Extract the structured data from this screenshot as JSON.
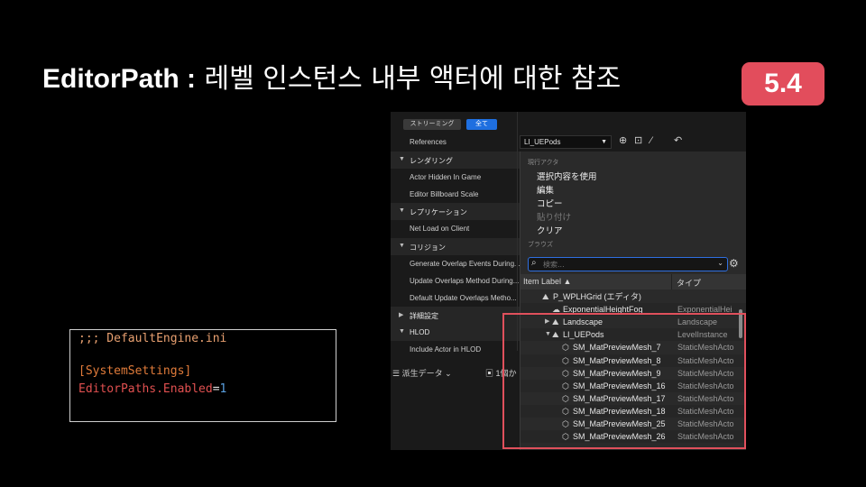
{
  "title": {
    "bold": "EditorPath :",
    "rest": " 레벨 인스턴스 내부 액터에 대한 참조"
  },
  "version_badge": "5.4",
  "code": {
    "line1": ";;; DefaultEngine.ini",
    "line2": "[SystemSettings]",
    "key": "EditorPaths.Enabled",
    "eq": "=",
    "value": "1"
  },
  "details_panel": {
    "streaming_tab": "ストリーミング",
    "all_tab": "全て",
    "references_label": "References",
    "references_value": "LI_UEPods",
    "rows": [
      {
        "kind": "cat",
        "label": "レンダリング"
      },
      {
        "kind": "prop",
        "label": "Actor Hidden In Game"
      },
      {
        "kind": "prop",
        "label": "Editor Billboard Scale"
      },
      {
        "kind": "cat",
        "label": "レプリケーション"
      },
      {
        "kind": "prop",
        "label": "Net Load on Client"
      },
      {
        "kind": "cat",
        "label": "コリジョン"
      },
      {
        "kind": "prop",
        "label": "Generate Overlap Events During..."
      },
      {
        "kind": "prop",
        "label": "Update Overlaps Method During..."
      },
      {
        "kind": "prop",
        "label": "Default Update Overlaps Metho..."
      },
      {
        "kind": "cat-collapsed",
        "label": "詳細設定"
      },
      {
        "kind": "cat",
        "label": "HLOD"
      },
      {
        "kind": "prop",
        "label": "Include Actor in HLOD"
      }
    ],
    "bottom_bar": {
      "derived_data": "派生データ",
      "next": "1個か"
    }
  },
  "menu": {
    "current_actor_header": "現行アクタ",
    "items": [
      "選択内容を使用",
      "編集",
      "コピー",
      "貼り付け",
      "クリア"
    ],
    "browse_header": "ブラウズ",
    "search_placeholder": "検索...",
    "columns": {
      "label": "Item Label",
      "type": "タイプ"
    },
    "tree": [
      {
        "label": "P_WPLHGrid (エディタ)",
        "type": "",
        "indent": 0,
        "icon": "level-icon",
        "exp": ""
      },
      {
        "label": "ExponentialHeightFog",
        "type": "ExponentialHei",
        "indent": 1,
        "icon": "fog-icon",
        "exp": ""
      },
      {
        "label": "Landscape",
        "type": "Landscape",
        "indent": 1,
        "icon": "landscape-icon",
        "exp": "▶"
      },
      {
        "label": "LI_UEPods",
        "type": "LevelInstance",
        "indent": 1,
        "icon": "level-instance-icon",
        "exp": "▼"
      },
      {
        "label": "SM_MatPreviewMesh_7",
        "type": "StaticMeshActo",
        "indent": 2,
        "icon": "mesh-icon",
        "exp": ""
      },
      {
        "label": "SM_MatPreviewMesh_8",
        "type": "StaticMeshActo",
        "indent": 2,
        "icon": "mesh-icon",
        "exp": ""
      },
      {
        "label": "SM_MatPreviewMesh_9",
        "type": "StaticMeshActo",
        "indent": 2,
        "icon": "mesh-icon",
        "exp": ""
      },
      {
        "label": "SM_MatPreviewMesh_16",
        "type": "StaticMeshActo",
        "indent": 2,
        "icon": "mesh-icon",
        "exp": ""
      },
      {
        "label": "SM_MatPreviewMesh_17",
        "type": "StaticMeshActo",
        "indent": 2,
        "icon": "mesh-icon",
        "exp": ""
      },
      {
        "label": "SM_MatPreviewMesh_18",
        "type": "StaticMeshActo",
        "indent": 2,
        "icon": "mesh-icon",
        "exp": ""
      },
      {
        "label": "SM_MatPreviewMesh_25",
        "type": "StaticMeshActo",
        "indent": 2,
        "icon": "mesh-icon",
        "exp": ""
      },
      {
        "label": "SM_MatPreviewMesh_26",
        "type": "StaticMeshActo",
        "indent": 2,
        "icon": "mesh-icon",
        "exp": ""
      }
    ]
  },
  "colors": {
    "accent_blue": "#1e6fe0",
    "badge_red": "#e24d5c",
    "highlight_red": "#e0505c"
  }
}
